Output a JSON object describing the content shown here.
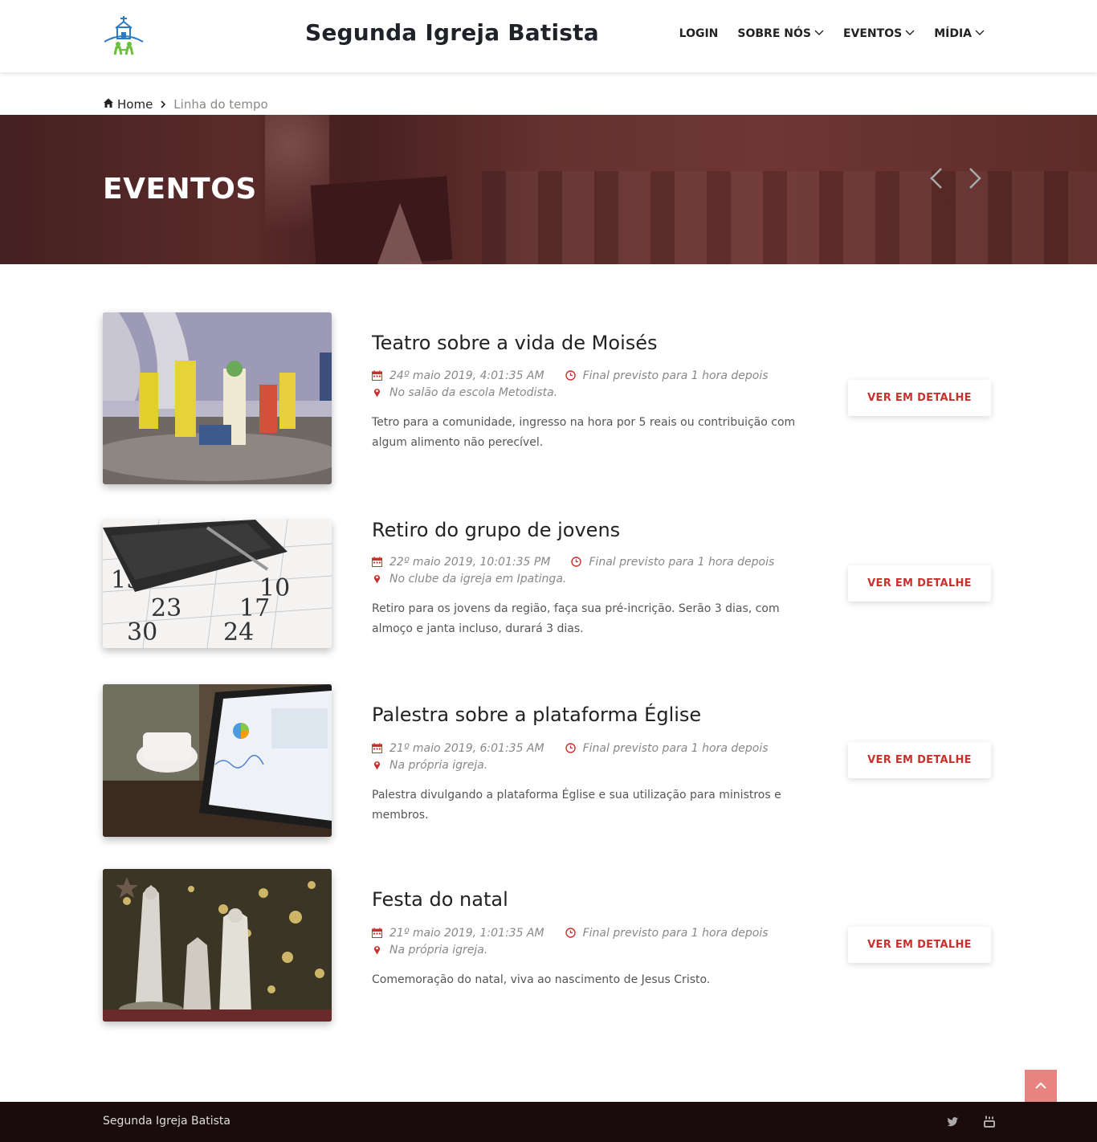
{
  "header": {
    "site_title": "Segunda Igreja Batista",
    "nav": [
      {
        "label": "LOGIN",
        "dropdown": false
      },
      {
        "label": "SOBRE NÓS",
        "dropdown": true
      },
      {
        "label": "EVENTOS",
        "dropdown": true
      },
      {
        "label": "MÍDIA",
        "dropdown": true
      }
    ]
  },
  "breadcrumb": {
    "home": "Home",
    "current": "Linha do tempo"
  },
  "banner": {
    "title": "EVENTOS"
  },
  "events": [
    {
      "title": "Teatro sobre a vida de Moisés",
      "date": "24º maio 2019, 4:01:35 AM",
      "end": "Final previsto para 1 hora depois",
      "location": "No salão da escola Metodista.",
      "description": "Tetro para a comunidade, ingresso na hora por 5 reais ou contribuição com algum alimento não perecível.",
      "button": "VER EM DETALHE",
      "image": "theater-photo"
    },
    {
      "title": "Retiro do grupo de jovens",
      "date": "22º maio 2019, 10:01:35 PM",
      "end": "Final previsto para 1 hora depois",
      "location": "No clube da igreja em Ipatinga.",
      "description": "Retiro para os jovens da região, faça sua pré-incrição. Serão 3 dias, com almoço e janta incluso, durará 3 dias.",
      "button": "VER EM DETALHE",
      "image": "calendar-photo"
    },
    {
      "title": "Palestra sobre a plataforma Église",
      "date": "21º maio 2019, 6:01:35 AM",
      "end": "Final previsto para 1 hora depois",
      "location": "Na própria igreja.",
      "description": "Palestra divulgando a plataforma Église e sua utilização para ministros e membros.",
      "button": "VER EM DETALHE",
      "image": "tablet-photo"
    },
    {
      "title": "Festa do natal",
      "date": "21º maio 2019, 1:01:35 AM",
      "end": "Final previsto para 1 hora depois",
      "location": "Na própria igreja.",
      "description": "Comemoração do natal, viva ao nascimento de Jesus Cristo.",
      "button": "VER EM DETALHE",
      "image": "nativity-photo"
    }
  ],
  "footer": {
    "text": "Segunda Igreja Batista",
    "social": [
      "twitter-icon",
      "youtube-icon"
    ]
  },
  "colors": {
    "accent": "#c9312c",
    "footer_bg": "#1a0c0c",
    "to_top": "#e8847f"
  }
}
